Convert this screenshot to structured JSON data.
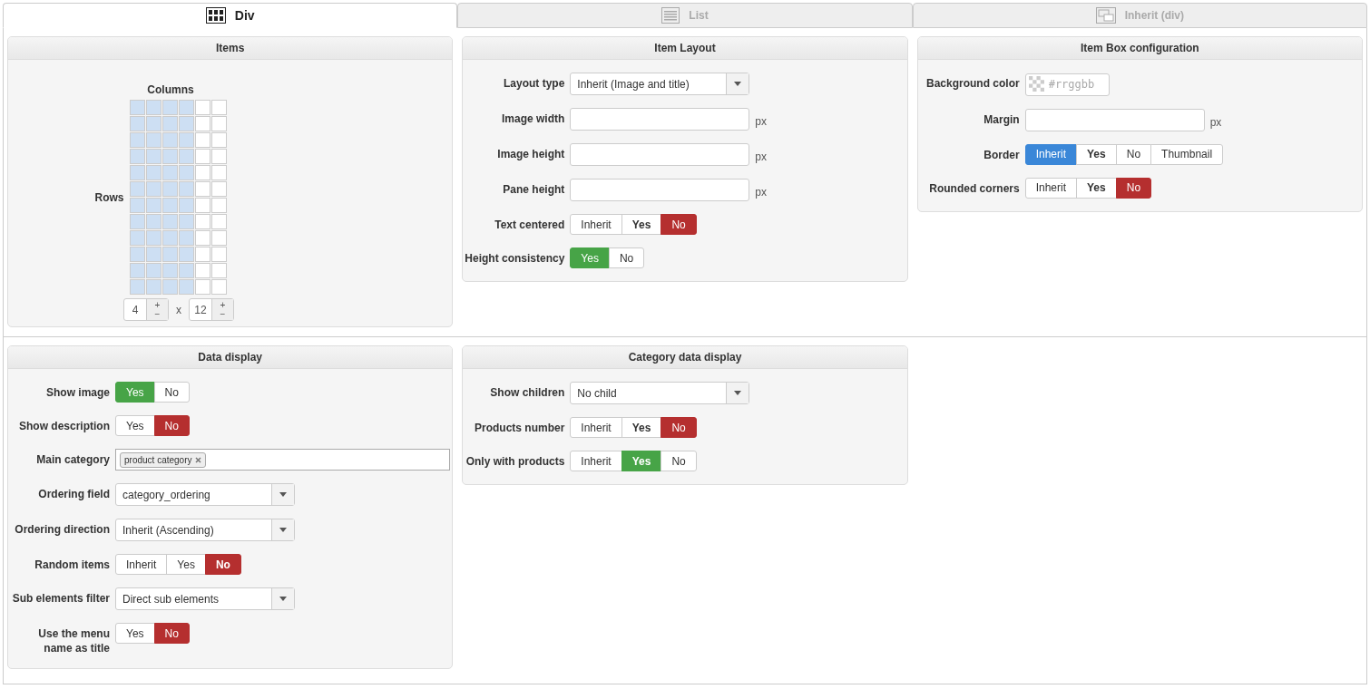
{
  "tabs": [
    {
      "label": "Div",
      "selected": true
    },
    {
      "label": "List",
      "selected": false
    },
    {
      "label": "Inherit (div)",
      "selected": false
    }
  ],
  "rows": [
    {
      "panels": [
        {
          "title": "Items",
          "fields": [
            {
              "kind": "grid",
              "columns_label": "Columns",
              "rows_label": "Rows",
              "columns": "4",
              "rows": "12",
              "separator": "x",
              "plus": "+",
              "minus": "−"
            }
          ]
        },
        {
          "title": "Item Layout",
          "fields": [
            {
              "kind": "select",
              "label": "Layout type",
              "value": "Inherit (Image and title)"
            },
            {
              "kind": "text",
              "label": "Image width",
              "unit": "px"
            },
            {
              "kind": "text",
              "label": "Image height",
              "unit": "px"
            },
            {
              "kind": "text",
              "label": "Pane height",
              "unit": "px"
            },
            {
              "kind": "toggle",
              "label": "Text centered",
              "options": [
                {
                  "label": "Inherit",
                  "selected": false,
                  "default": false
                },
                {
                  "label": "Yes",
                  "selected": false,
                  "default": true
                },
                {
                  "label": "No",
                  "selected": true,
                  "default": false,
                  "color": "#b52f2f"
                }
              ]
            },
            {
              "kind": "toggle",
              "label": "Height consistency",
              "options": [
                {
                  "label": "Yes",
                  "selected": true,
                  "default": false,
                  "color": "#47a447"
                },
                {
                  "label": "No",
                  "selected": false,
                  "default": false
                }
              ]
            }
          ]
        },
        {
          "title": "Item Box configuration",
          "fields": [
            {
              "kind": "color",
              "label": "Background color",
              "placeholder": "#rrggbb"
            },
            {
              "kind": "text",
              "label": "Margin",
              "unit": "px"
            },
            {
              "kind": "toggle",
              "label": "Border",
              "options": [
                {
                  "label": "Inherit",
                  "selected": true,
                  "default": false,
                  "color": "#3a87d8"
                },
                {
                  "label": "Yes",
                  "selected": false,
                  "default": true
                },
                {
                  "label": "No",
                  "selected": false,
                  "default": false
                },
                {
                  "label": "Thumbnail",
                  "selected": false,
                  "default": false
                }
              ]
            },
            {
              "kind": "toggle",
              "label": "Rounded corners",
              "options": [
                {
                  "label": "Inherit",
                  "selected": false,
                  "default": false
                },
                {
                  "label": "Yes",
                  "selected": false,
                  "default": true
                },
                {
                  "label": "No",
                  "selected": true,
                  "default": false,
                  "color": "#b52f2f"
                }
              ]
            }
          ]
        }
      ]
    },
    {
      "panels": [
        {
          "title": "Data display",
          "fields": [
            {
              "kind": "toggle",
              "label": "Show image",
              "options": [
                {
                  "label": "Yes",
                  "selected": true,
                  "default": false,
                  "color": "#47a447"
                },
                {
                  "label": "No",
                  "selected": false,
                  "default": false
                }
              ]
            },
            {
              "kind": "toggle",
              "label": "Show description",
              "options": [
                {
                  "label": "Yes",
                  "selected": false,
                  "default": false
                },
                {
                  "label": "No",
                  "selected": true,
                  "default": false,
                  "color": "#b52f2f"
                }
              ]
            },
            {
              "kind": "tags",
              "label": "Main category",
              "tags": [
                "product category"
              ]
            },
            {
              "kind": "select",
              "label": "Ordering field",
              "value": "category_ordering"
            },
            {
              "kind": "select",
              "label": "Ordering direction",
              "value": "Inherit (Ascending)"
            },
            {
              "kind": "toggle",
              "label": "Random items",
              "options": [
                {
                  "label": "Inherit",
                  "selected": false,
                  "default": false
                },
                {
                  "label": "Yes",
                  "selected": false,
                  "default": false
                },
                {
                  "label": "No",
                  "selected": true,
                  "default": true,
                  "color": "#b52f2f"
                }
              ]
            },
            {
              "kind": "select",
              "label": "Sub elements filter",
              "value": "Direct sub elements"
            },
            {
              "kind": "toggle",
              "label": "Use the menu name as title",
              "options": [
                {
                  "label": "Yes",
                  "selected": false,
                  "default": false
                },
                {
                  "label": "No",
                  "selected": true,
                  "default": false,
                  "color": "#b52f2f"
                }
              ]
            }
          ]
        },
        {
          "title": "Category data display",
          "fields": [
            {
              "kind": "select",
              "label": "Show children",
              "value": "No child"
            },
            {
              "kind": "toggle",
              "label": "Products number",
              "options": [
                {
                  "label": "Inherit",
                  "selected": false,
                  "default": false
                },
                {
                  "label": "Yes",
                  "selected": false,
                  "default": true
                },
                {
                  "label": "No",
                  "selected": true,
                  "default": false,
                  "color": "#b52f2f"
                }
              ]
            },
            {
              "kind": "toggle",
              "label": "Only with products",
              "options": [
                {
                  "label": "Inherit",
                  "selected": false,
                  "default": false
                },
                {
                  "label": "Yes",
                  "selected": true,
                  "default": true,
                  "color": "#47a447"
                },
                {
                  "label": "No",
                  "selected": false,
                  "default": false
                }
              ]
            }
          ]
        }
      ]
    }
  ]
}
